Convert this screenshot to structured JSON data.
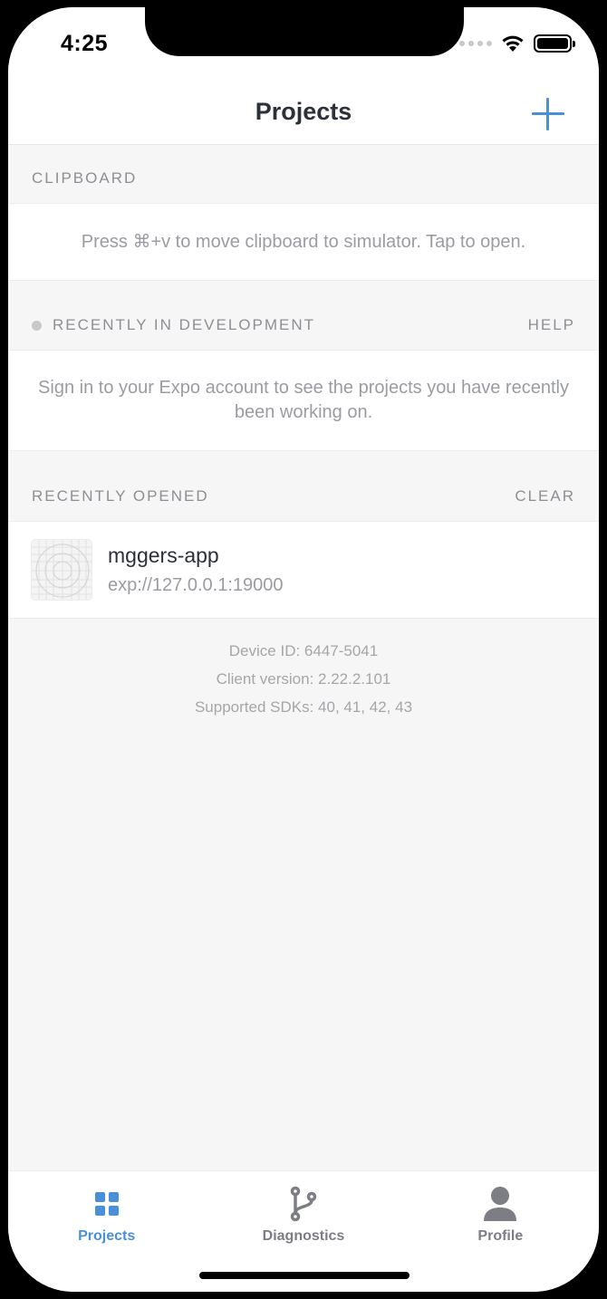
{
  "status_bar": {
    "time": "4:25"
  },
  "header": {
    "title": "Projects"
  },
  "clipboard": {
    "header": "CLIPBOARD",
    "message": "Press ⌘+v to move clipboard to simulator. Tap to open."
  },
  "recent_development": {
    "header": "RECENTLY IN DEVELOPMENT",
    "action": "HELP",
    "message": "Sign in to your Expo account to see the projects you have recently been working on."
  },
  "recently_opened": {
    "header": "RECENTLY OPENED",
    "action": "CLEAR",
    "projects": [
      {
        "name": "mggers-app",
        "url": "exp://127.0.0.1:19000"
      }
    ]
  },
  "device_info": {
    "device_id": "Device ID: 6447-5041",
    "client_version": "Client version: 2.22.2.101",
    "supported_sdks": "Supported SDKs: 40, 41, 42, 43"
  },
  "tabs": [
    {
      "label": "Projects",
      "icon": "grid-icon",
      "active": true
    },
    {
      "label": "Diagnostics",
      "icon": "branch-icon",
      "active": false
    },
    {
      "label": "Profile",
      "icon": "person-icon",
      "active": false
    }
  ],
  "colors": {
    "accent": "#4a90d9",
    "background": "#f6f6f6",
    "muted_text": "#9a9ca1"
  }
}
